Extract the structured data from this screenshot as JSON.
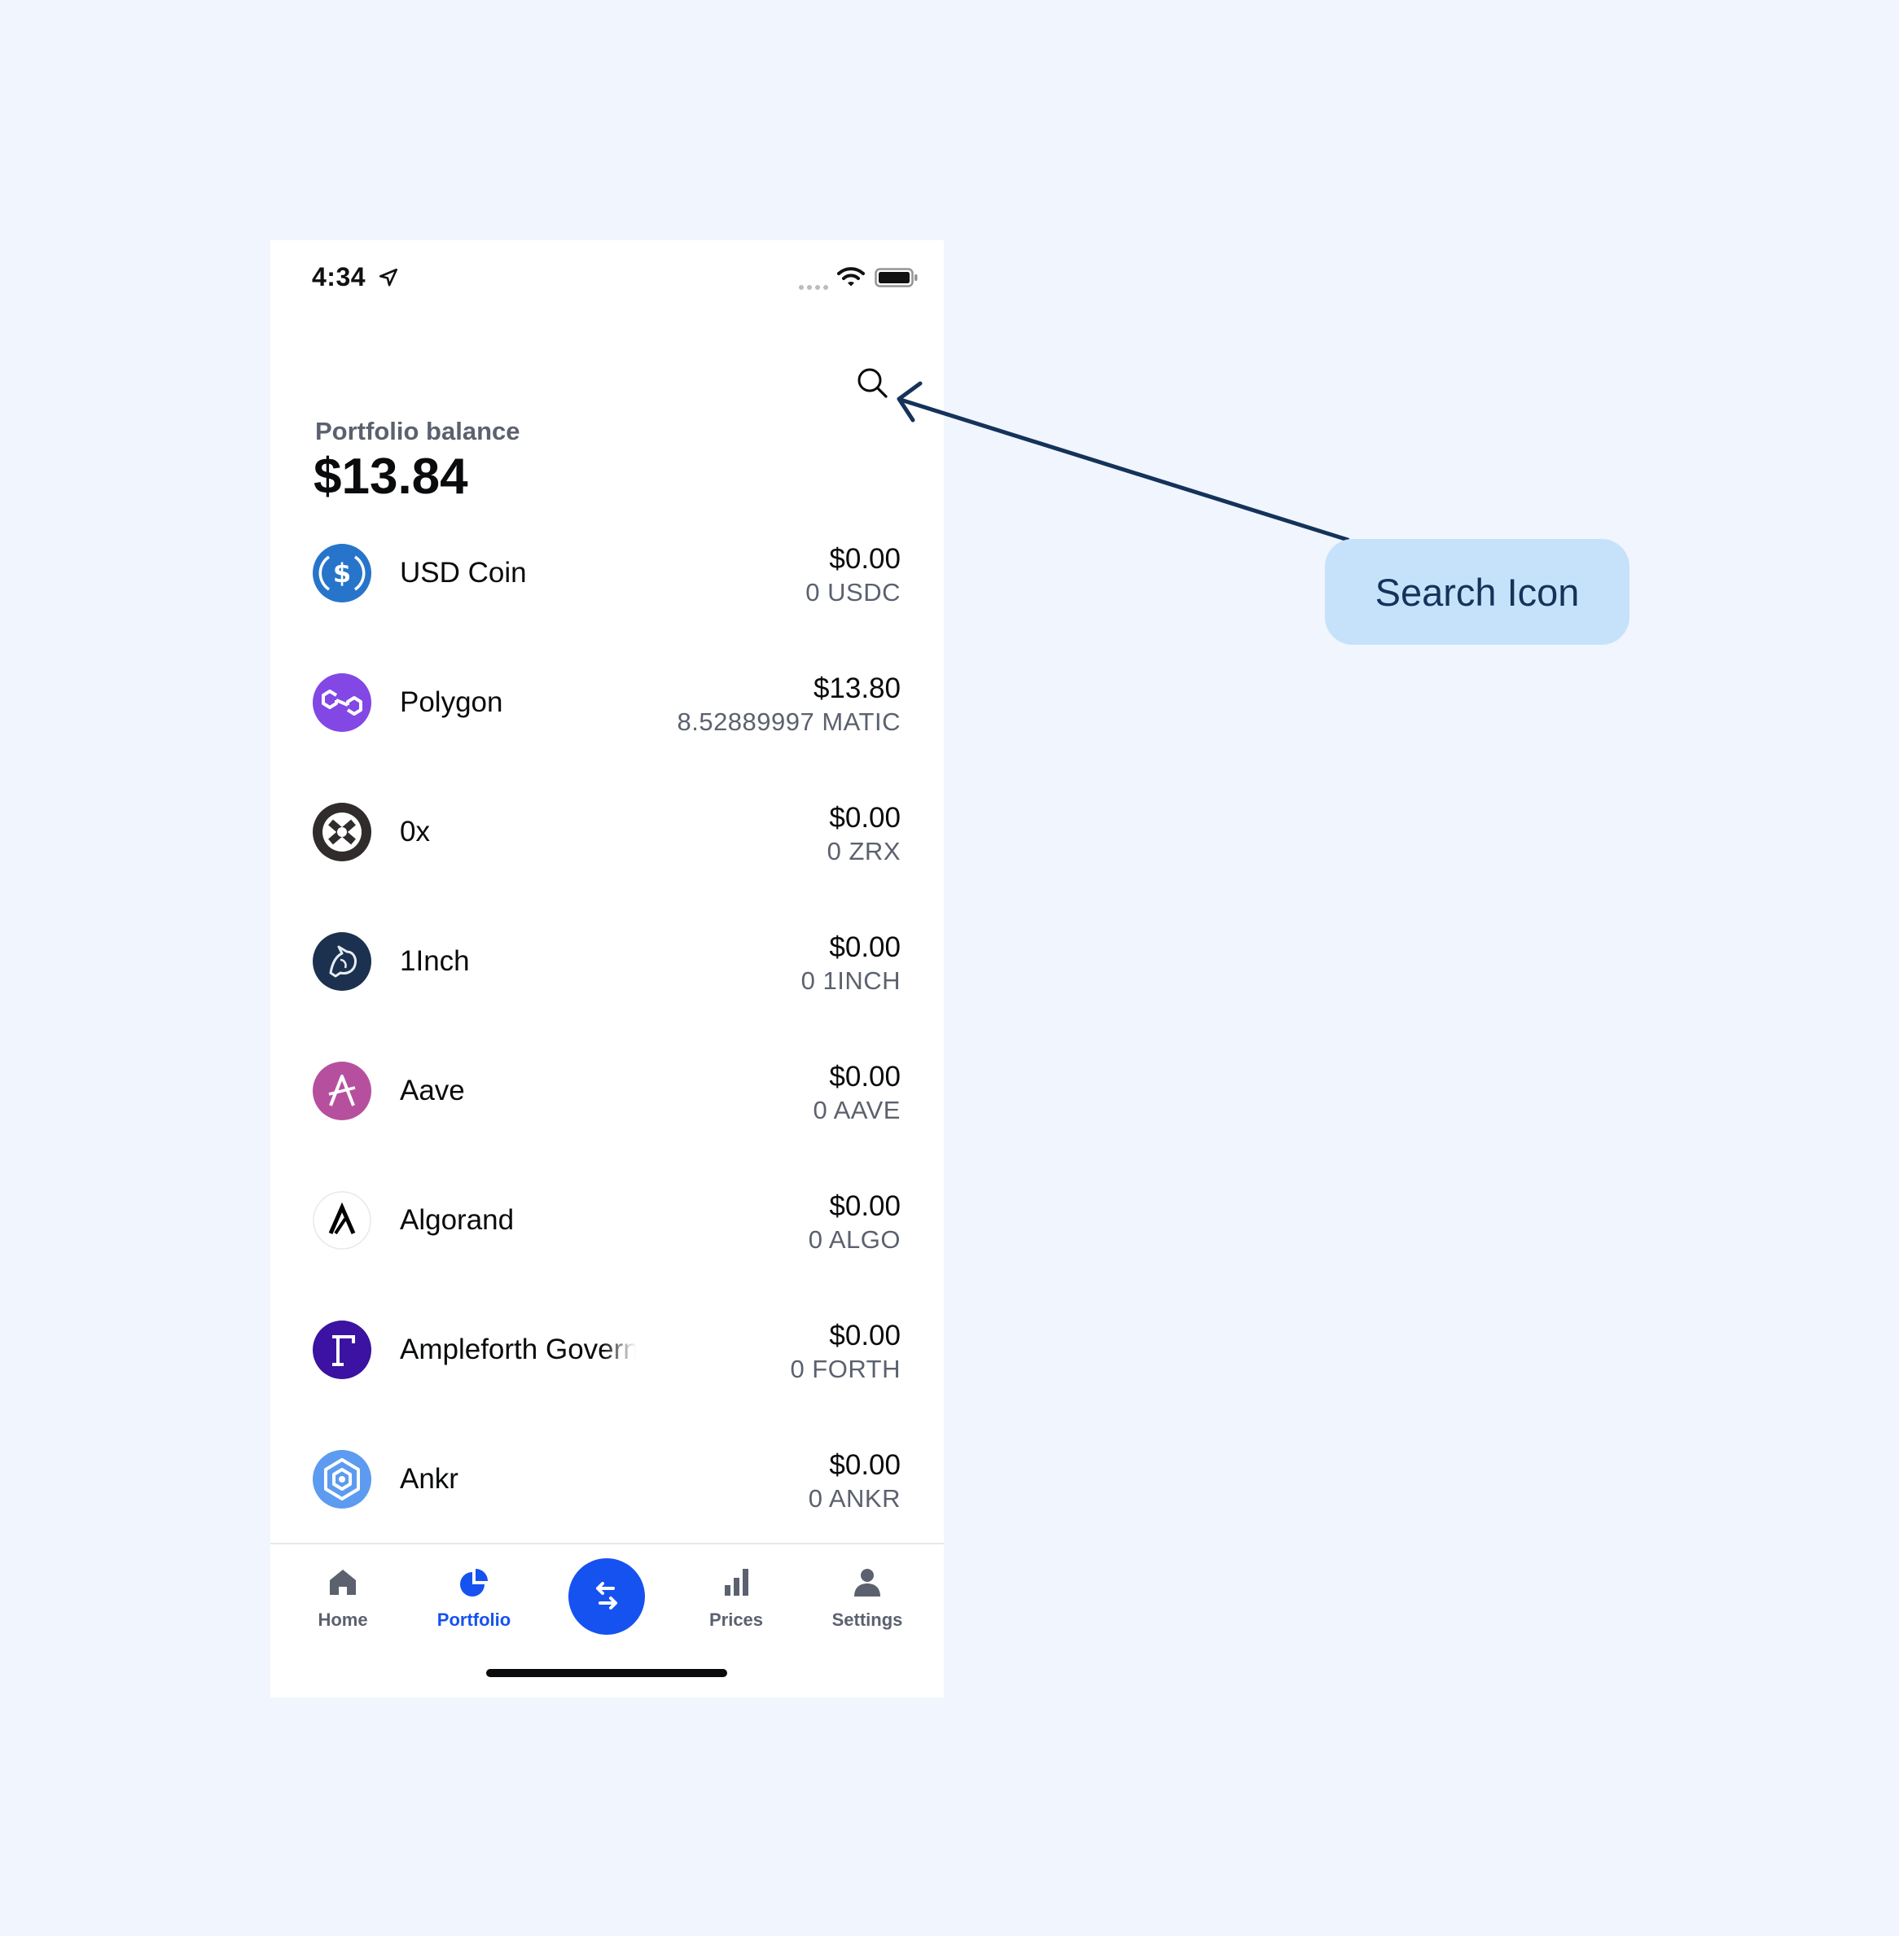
{
  "status_bar": {
    "time": "4:34"
  },
  "portfolio": {
    "label": "Portfolio balance",
    "balance": "$13.84"
  },
  "assets": [
    {
      "name": "USD Coin",
      "fiat": "$0.00",
      "crypto": "0 USDC",
      "icon": "usd-coin-icon",
      "color": "#2775ca"
    },
    {
      "name": "Polygon",
      "fiat": "$13.80",
      "crypto": "8.52889997 MATIC",
      "icon": "polygon-icon",
      "color": "#8247e5"
    },
    {
      "name": "0x",
      "fiat": "$0.00",
      "crypto": "0 ZRX",
      "icon": "zrx-icon",
      "color": "#302c2c"
    },
    {
      "name": "1Inch",
      "fiat": "$0.00",
      "crypto": "0 1INCH",
      "icon": "1inch-icon",
      "color": "#1b314f"
    },
    {
      "name": "Aave",
      "fiat": "$0.00",
      "crypto": "0 AAVE",
      "icon": "aave-icon",
      "color": "#b6509e"
    },
    {
      "name": "Algorand",
      "fiat": "$0.00",
      "crypto": "0 ALGO",
      "icon": "algorand-icon",
      "color": "#000000"
    },
    {
      "name": "Ampleforth Governance Token",
      "fiat": "$0.00",
      "crypto": "0 FORTH",
      "icon": "ampleforth-icon",
      "color": "#3b12a1"
    },
    {
      "name": "Ankr",
      "fiat": "$0.00",
      "crypto": "0 ANKR",
      "icon": "ankr-icon",
      "color": "#2e6bf6"
    }
  ],
  "tabs": [
    {
      "label": "Home",
      "icon": "home-icon",
      "active": false
    },
    {
      "label": "Portfolio",
      "icon": "pie-chart-icon",
      "active": true
    },
    {
      "label": "Prices",
      "icon": "bar-chart-icon",
      "active": false
    },
    {
      "label": "Settings",
      "icon": "person-icon",
      "active": false
    }
  ],
  "trade_button": {
    "icon": "swap-arrows-icon",
    "color": "#1652f0"
  },
  "annotation": {
    "label": "Search Icon"
  }
}
